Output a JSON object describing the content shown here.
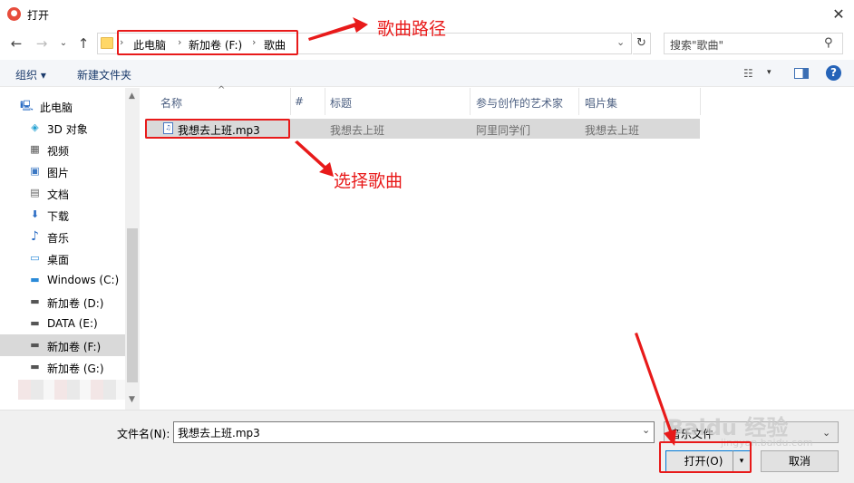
{
  "window": {
    "title": "打开",
    "close_glyph": "✕"
  },
  "nav": {
    "back": "←",
    "forward": "→",
    "recent": "⌄",
    "up": "↑"
  },
  "address": {
    "crumbs": [
      "此电脑",
      "新加卷 (F:)",
      "歌曲"
    ],
    "separator": "›",
    "dropdown": "⌄",
    "refresh": "↻"
  },
  "search": {
    "placeholder": "搜索\"歌曲\"",
    "icon": "⚲"
  },
  "toolbar": {
    "organize": "组织 ▾",
    "new_folder": "新建文件夹",
    "view_icon": "☷",
    "view_drop": "▾",
    "help": "?"
  },
  "sidebar": {
    "items": [
      {
        "label": "此电脑",
        "icon": "computer-icon",
        "glyph": "🖳"
      },
      {
        "label": "3D 对象",
        "icon": "3d-objects-icon",
        "glyph": "◈"
      },
      {
        "label": "视频",
        "icon": "video-icon",
        "glyph": "▦"
      },
      {
        "label": "图片",
        "icon": "pictures-icon",
        "glyph": "▣"
      },
      {
        "label": "文档",
        "icon": "documents-icon",
        "glyph": "▤"
      },
      {
        "label": "下载",
        "icon": "download-icon",
        "glyph": "⬇"
      },
      {
        "label": "音乐",
        "icon": "music-icon",
        "glyph": "♪"
      },
      {
        "label": "桌面",
        "icon": "desktop-icon",
        "glyph": "▭"
      },
      {
        "label": "Windows (C:)",
        "icon": "windows-drive-icon",
        "glyph": "▬"
      },
      {
        "label": "新加卷 (D:)",
        "icon": "drive-icon",
        "glyph": "▬"
      },
      {
        "label": "DATA (E:)",
        "icon": "drive-icon",
        "glyph": "▬"
      },
      {
        "label": "新加卷 (F:)",
        "icon": "drive-icon",
        "glyph": "▬",
        "selected": true
      },
      {
        "label": "新加卷 (G:)",
        "icon": "drive-icon",
        "glyph": "▬"
      }
    ],
    "scroll_up": "▲",
    "scroll_down": "▼"
  },
  "file_list": {
    "columns": [
      "名称",
      "#",
      "标题",
      "参与创作的艺术家",
      "唱片集"
    ],
    "sort_arrow": "^",
    "rows": [
      {
        "name": "我想去上班.mp3",
        "number": "",
        "title": "我想去上班",
        "artist": "阿里同学们",
        "album": "我想去上班",
        "icon_glyph": "♫"
      }
    ]
  },
  "bottom": {
    "filename_label": "文件名(N):",
    "filename_value": "我想去上班.mp3",
    "filename_drop": "⌄",
    "filter_value": "音乐文件",
    "filter_drop": "⌄",
    "open_label": "打开(O)",
    "open_split": "▾",
    "cancel_label": "取消"
  },
  "annotations": {
    "path_label": "歌曲路径",
    "select_label": "选择歌曲",
    "color": "#e81a1a"
  },
  "watermark": {
    "text": "Baidu 经验",
    "sub": "jingyan.baidu.com"
  }
}
